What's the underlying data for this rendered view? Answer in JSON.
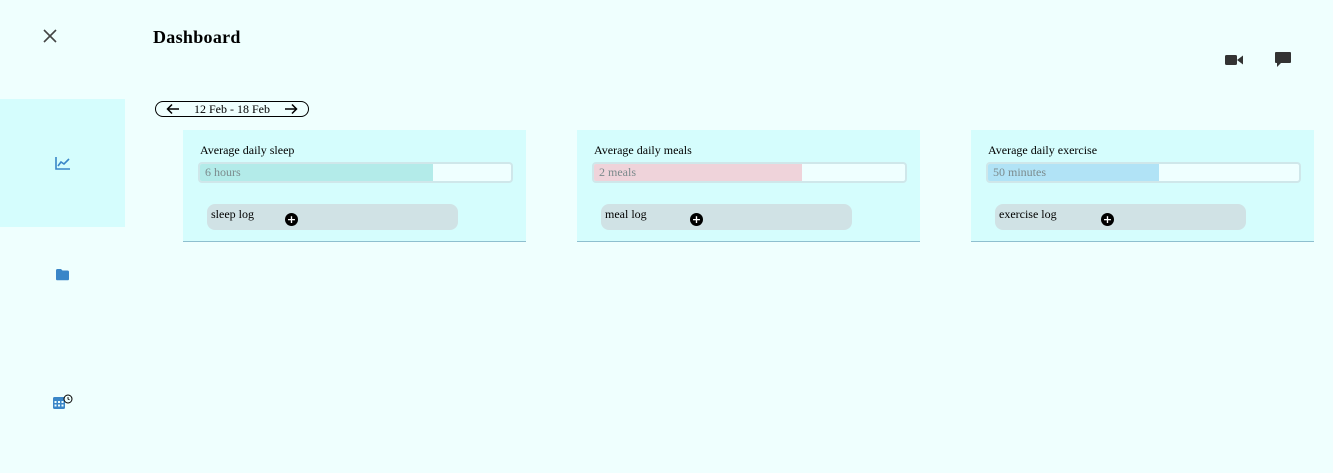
{
  "header": {
    "title": "Dashboard"
  },
  "sidebar": {
    "items": [
      {
        "icon": "chart-line-icon",
        "active": true
      },
      {
        "icon": "folder-icon",
        "active": false
      },
      {
        "icon": "calendar-clock-icon",
        "active": false
      }
    ]
  },
  "toolbar": {
    "icons": [
      "video-camera-icon",
      "chat-bubble-icon"
    ]
  },
  "date_range": {
    "label": "12 Feb - 18 Feb"
  },
  "cards": [
    {
      "title": "Average daily sleep",
      "value_text": "6 hours",
      "progress": 0.75,
      "fill_color": "#b3ebe9",
      "log_label": "sleep log"
    },
    {
      "title": "Average daily meals",
      "value_text": "2 meals",
      "progress": 0.67,
      "fill_color": "#efd3da",
      "log_label": "meal log"
    },
    {
      "title": "Average daily exercise",
      "value_text": "50 minutes",
      "progress": 0.55,
      "fill_color": "#b1e3f6",
      "log_label": "exercise log"
    }
  ],
  "colors": {
    "background": "#effffe",
    "card": "#d5fdfd",
    "accent": "#3a86c8",
    "icon_dark": "#333333"
  }
}
